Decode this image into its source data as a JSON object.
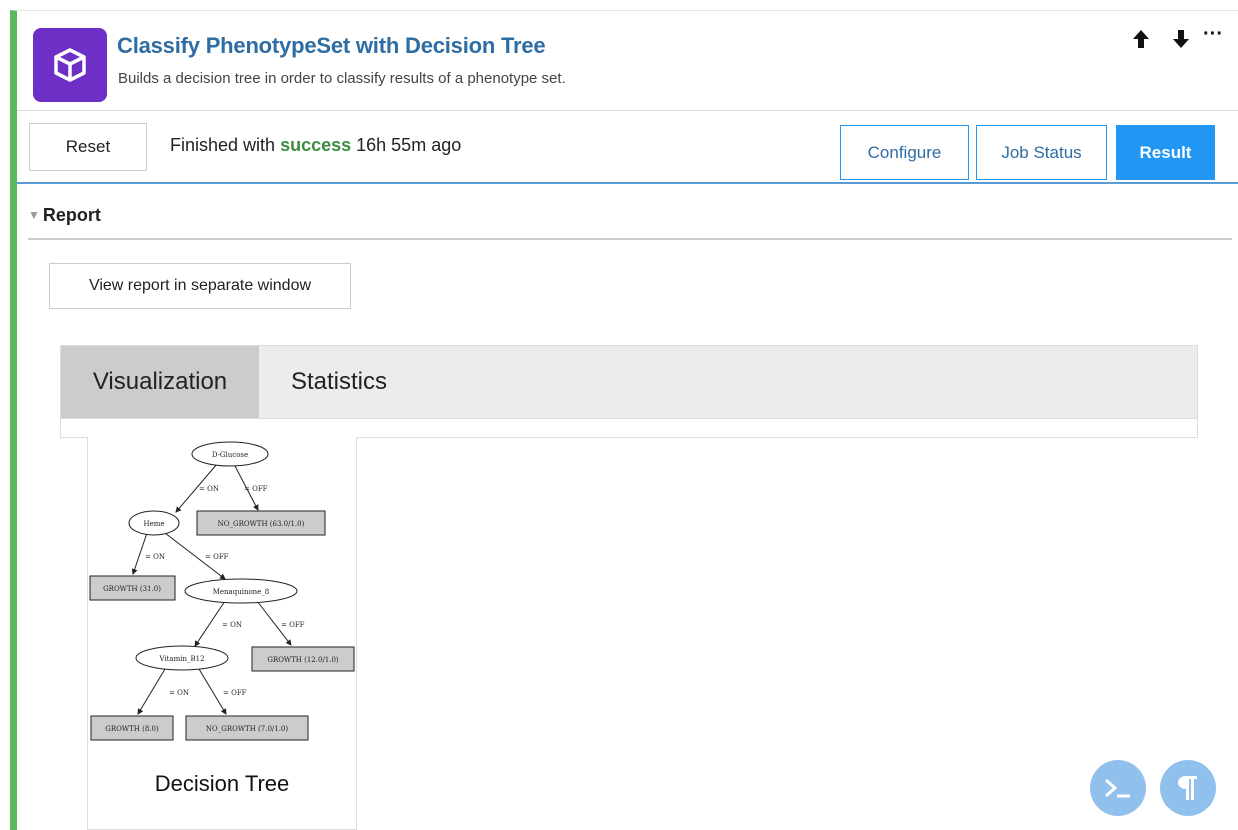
{
  "app": {
    "title": "Classify PhenotypeSet with Decision Tree",
    "subtitle": "Builds a decision tree in order to classify results of a phenotype set.",
    "icon": "cube-icon",
    "icon_bg": "#6e2fc7"
  },
  "controls": {
    "move_up": "↑",
    "move_down": "↓",
    "more": "···"
  },
  "toolbar": {
    "reset_label": "Reset",
    "status_prefix": "Finished with",
    "status_word": "success",
    "status_suffix": "16h 55m ago",
    "tabs": {
      "configure": "Configure",
      "job_status": "Job Status",
      "result": "Result"
    },
    "active_tab": "Result",
    "accent": "#2196f3"
  },
  "report": {
    "heading": "Report",
    "view_button": "View report in separate window",
    "tabs": {
      "visualization": "Visualization",
      "statistics": "Statistics"
    },
    "active_tab": "Visualization",
    "figure_caption": "Decision Tree",
    "tree": {
      "nodes": {
        "dglucose": "D-Glucose",
        "heme": "Heme",
        "menaquinone": "Menaquinone_8",
        "vitamin": "Vitamin_B12"
      },
      "leaves": {
        "nogrowth1": "NO_GROWTH (63.0/1.0)",
        "growth1": "GROWTH (31.0)",
        "growth2": "GROWTH (12.0/1.0)",
        "growth3": "GROWTH (8.0)",
        "nogrowth2": "NO_GROWTH (7.0/1.0)"
      },
      "edges": {
        "on": "= ON",
        "off": "= OFF"
      }
    }
  },
  "fabs": {
    "terminal": "terminal-icon",
    "pilcrow": "pilcrow-icon"
  },
  "colors": {
    "cell_border": "#5cb85c",
    "success": "#3e8e41",
    "title": "#2e6da4"
  }
}
